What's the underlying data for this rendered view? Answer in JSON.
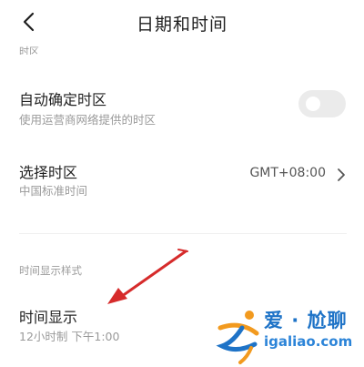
{
  "header": {
    "title": "日期和时间"
  },
  "section_timezone": {
    "cut_label": "时区"
  },
  "auto_timezone": {
    "title": "自动确定时区",
    "subtitle": "使用运营商网络提供的时区",
    "enabled": false
  },
  "select_timezone": {
    "title": "选择时区",
    "subtitle": "中国标准时间",
    "value": "GMT+08:00"
  },
  "section_time_display": {
    "label": "时间显示样式"
  },
  "time_display": {
    "title": "时间显示",
    "subtitle": "12小时制 下午1:00"
  },
  "watermark": {
    "cn": "爱 · 尬聊",
    "en": "igaliao.com"
  },
  "colors": {
    "annotation_arrow": "#d62b2b",
    "watermark_blue": "#1e73c7",
    "watermark_orange": "#f29a1f"
  }
}
